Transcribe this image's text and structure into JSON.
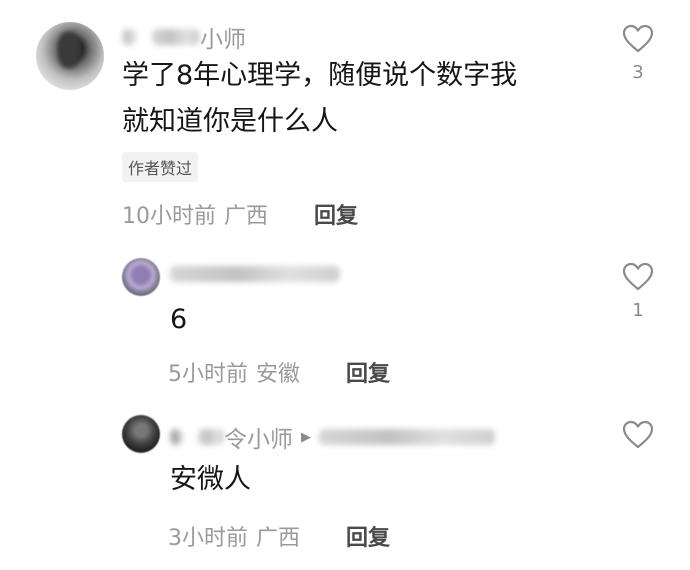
{
  "comments": [
    {
      "username_suffix": "小师",
      "text_line1": "学了8年心理学，随便说个数字我",
      "text_line2": "就知道你是什么人",
      "badge": "作者赞过",
      "time": "10小时前",
      "location": "广西",
      "reply_label": "回复",
      "like_count": "3"
    }
  ],
  "replies": [
    {
      "text": "6",
      "time": "5小时前",
      "location": "安徽",
      "reply_label": "回复",
      "like_count": "1"
    },
    {
      "username_suffix": "令小师",
      "text": "安微人",
      "time": "3小时前",
      "location": "广西",
      "reply_label": "回复",
      "like_count": ""
    }
  ],
  "icons": {
    "like": "heart-outline-icon",
    "reply_arrow": "triangle-right-icon"
  }
}
